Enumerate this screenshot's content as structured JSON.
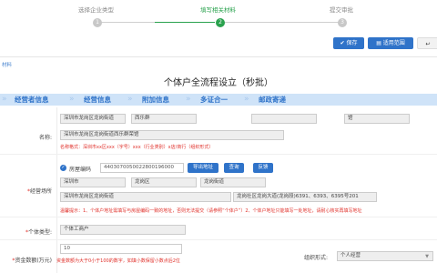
{
  "stepper": {
    "steps": [
      {
        "num": "1",
        "label": "选择企业类型"
      },
      {
        "num": "2",
        "label": "填写相关材料"
      },
      {
        "num": "3",
        "label": "提交审批"
      }
    ],
    "active_index": 2,
    "accent": "#2aa24e"
  },
  "toolbar": {
    "save_label": "保存",
    "save_icon": "✔",
    "preview_label": "适用范围",
    "preview_icon": "▤",
    "back_icon": "↩"
  },
  "breadcrumb": "材料",
  "form_title": "个体户全流程设立（秒批）",
  "tabs": [
    "经营者信息",
    "经营信息",
    "附加信息",
    "多证合一",
    "邮政寄递"
  ],
  "fields": {
    "name": {
      "label": "名称:",
      "addr": [
        "深圳市龙岗区龙岗街道",
        "西乐群",
        "",
        "馆"
      ],
      "full": "深圳市龙岗区龙岗街道西乐群荣馆",
      "hint": "名称格式：深圳市xx区xxx（字号）xxx（行业类别）x店/商行（组织形式）"
    },
    "address": {
      "label": "经营场所",
      "required_mark": "*",
      "radio_label": "房屋编码",
      "code": "4403070050022800196000",
      "buttons": [
        "导出地址",
        "查询",
        "反馈"
      ],
      "city": "深圳市",
      "district": "龙岗区",
      "street": "龙岗街道",
      "line1": "深圳市龙岗区龙岗街道",
      "line2": "龙岗社区龙岗大道(龙岗段)6391、6393、6395号201",
      "hint": "温馨提示：1、个体户地址需填写与房屋编码一致的地址，否则无法提交（请参照“个体户”）2、个体户地址只能填写一处地址，请耐心核实再填写地址"
    },
    "type": {
      "label": "个体类型:",
      "required_mark": "*",
      "value": "个体工商户"
    },
    "capital": {
      "label": "资金数额(万元)",
      "required_mark": "*",
      "value": "10",
      "hint": "资金数额为大于0小于100的数字，如填小数保留小数点后2位"
    },
    "org": {
      "label": "组织形式:",
      "value": "个人经营"
    }
  }
}
